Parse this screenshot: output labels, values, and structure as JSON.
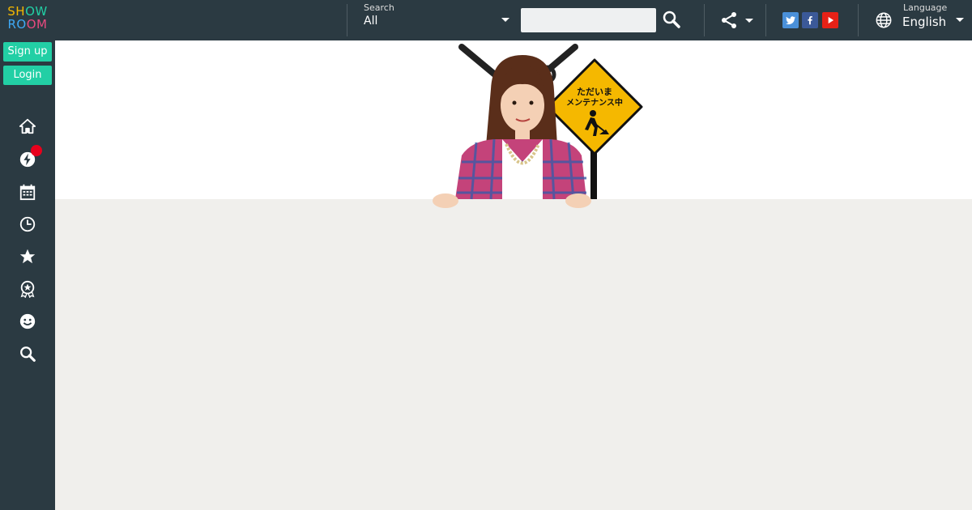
{
  "logo": {
    "letters_row1": [
      "S",
      "H",
      "O",
      "W"
    ],
    "letters_row2": [
      "R",
      "O",
      "O",
      "M"
    ],
    "colors_row1": [
      "#f5b800",
      "#f5b800",
      "#22cfa5",
      "#22cfa5"
    ],
    "colors_row2": [
      "#3fa9f5",
      "#3fa9f5",
      "#e84a7f",
      "#e84a7f"
    ]
  },
  "auth": {
    "signup_label": "Sign up",
    "login_label": "Login"
  },
  "nav_icons": [
    "home-icon",
    "lightning-icon",
    "calendar-icon",
    "clock-icon",
    "star-icon",
    "ribbon-icon",
    "smiley-icon",
    "search-icon"
  ],
  "header": {
    "search_label": "Search",
    "search_category": "All",
    "search_placeholder": "",
    "social": [
      {
        "name": "twitter-icon",
        "color": "#4a90d9"
      },
      {
        "name": "facebook-icon",
        "color": "#3b5998"
      },
      {
        "name": "youtube-icon",
        "color": "#e62117"
      }
    ],
    "language_label": "Language",
    "language_value": "English"
  },
  "maintenance": {
    "sign_line1": "ただいま",
    "sign_line2": "メンテナンス中",
    "sign_color": "#f5b800"
  },
  "colors": {
    "accent": "#22cfa5",
    "header_bg": "#2b3a42",
    "notification": "#e8001c",
    "page_bg": "#f0efec"
  }
}
